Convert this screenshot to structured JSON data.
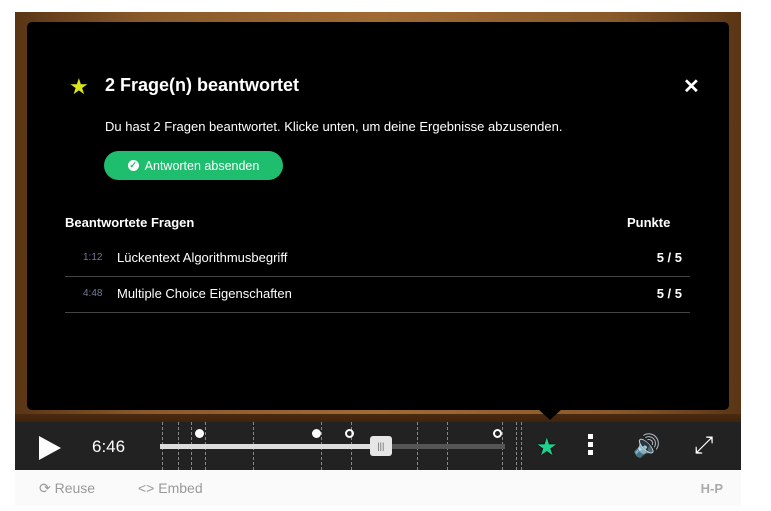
{
  "summary": {
    "title": "2 Frage(n) beantwortet",
    "description": "Du hast 2 Fragen beantwortet. Klicke unten, um deine Ergebnisse abzusenden.",
    "submit_label": "Antworten absenden",
    "col_questions": "Beantwortete Fragen",
    "col_points": "Punkte",
    "rows": [
      {
        "time": "1:12",
        "label": "Lückentext Algorithmusbegriff",
        "score": "5 / 5"
      },
      {
        "time": "4:48",
        "label": "Multiple Choice Eigenschaften",
        "score": "5 / 5"
      }
    ]
  },
  "player": {
    "current_time": "6:46",
    "progress_fraction": 0.64
  },
  "footer": {
    "reuse_label": "Reuse",
    "embed_label": "Embed",
    "logo_text": "H-P"
  },
  "colors": {
    "accent_green": "#1fbd6e",
    "star_yellow": "#d9e619"
  }
}
